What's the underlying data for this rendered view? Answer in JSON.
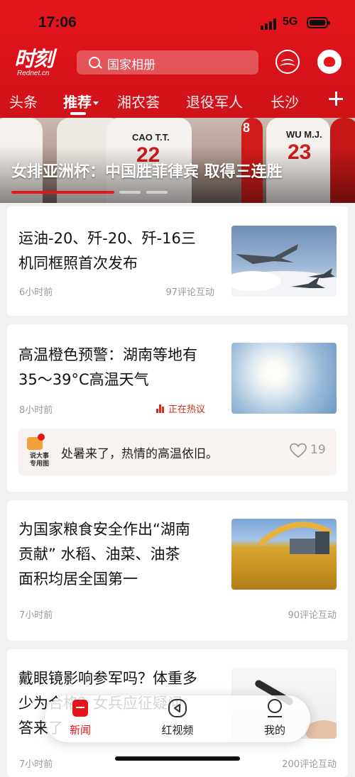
{
  "status_bar": {
    "time": "17:06",
    "network": "5G"
  },
  "header": {
    "logo_main": "时刻",
    "logo_sub": "Rednet.cn",
    "search_placeholder": "国家相册"
  },
  "tabs": [
    {
      "label": "头条",
      "active": false
    },
    {
      "label": "推荐",
      "active": true
    },
    {
      "label": "湘农荟",
      "active": false
    },
    {
      "label": "退役军人",
      "active": false
    },
    {
      "label": "长沙",
      "active": false
    }
  ],
  "banner": {
    "title": "女排亚洲杯：中国胜菲律宾 取得三连胜",
    "jerseys": [
      {
        "name": "CAO T.T.",
        "number": "22"
      },
      {
        "name": "WU M.J.",
        "number": "23"
      },
      {
        "name": "",
        "number": "8"
      }
    ]
  },
  "articles": [
    {
      "title_lines": [
        "运油-20、歼-20、歼-16三",
        "机同框照首次发布"
      ],
      "time": "6小时前",
      "comments": "97评论互动",
      "thumb_icon": "aircraft-formation-image"
    },
    {
      "title_lines": [
        "高温橙色预警：湖南等地有",
        "35～39°C高温天气"
      ],
      "time": "8小时前",
      "hot_label": "正在热议",
      "thumb_icon": "sun-sky-image",
      "quote": {
        "tag_line1": "说大事",
        "tag_line2": "专用图",
        "text": "处暑来了，热情的高温依旧。",
        "likes": "19"
      }
    },
    {
      "title_lines": [
        "为国家粮食安全作出“湖南",
        "贡献” 水稻、油菜、油茶",
        "面积均居全国第一"
      ],
      "time": "7小时前",
      "comments": "90评论互动",
      "thumb_icon": "grain-harvest-image"
    },
    {
      "title_lines": [
        "戴眼镜影响参军吗？体重多",
        "少为合格？女兵应征疑问",
        "答来了"
      ],
      "time": "7小时前",
      "comments": "200评论互动",
      "thumb_icon": "microphone-image"
    }
  ],
  "tabbar": [
    {
      "label": "新闻",
      "active": true,
      "icon": "news-icon"
    },
    {
      "label": "红视频",
      "active": false,
      "icon": "play-icon"
    },
    {
      "label": "我的",
      "active": false,
      "icon": "profile-icon"
    }
  ],
  "colors": {
    "brand_red": "#e5161b",
    "hot_red": "#d62a20",
    "meta_gray": "#9a9a9a"
  }
}
